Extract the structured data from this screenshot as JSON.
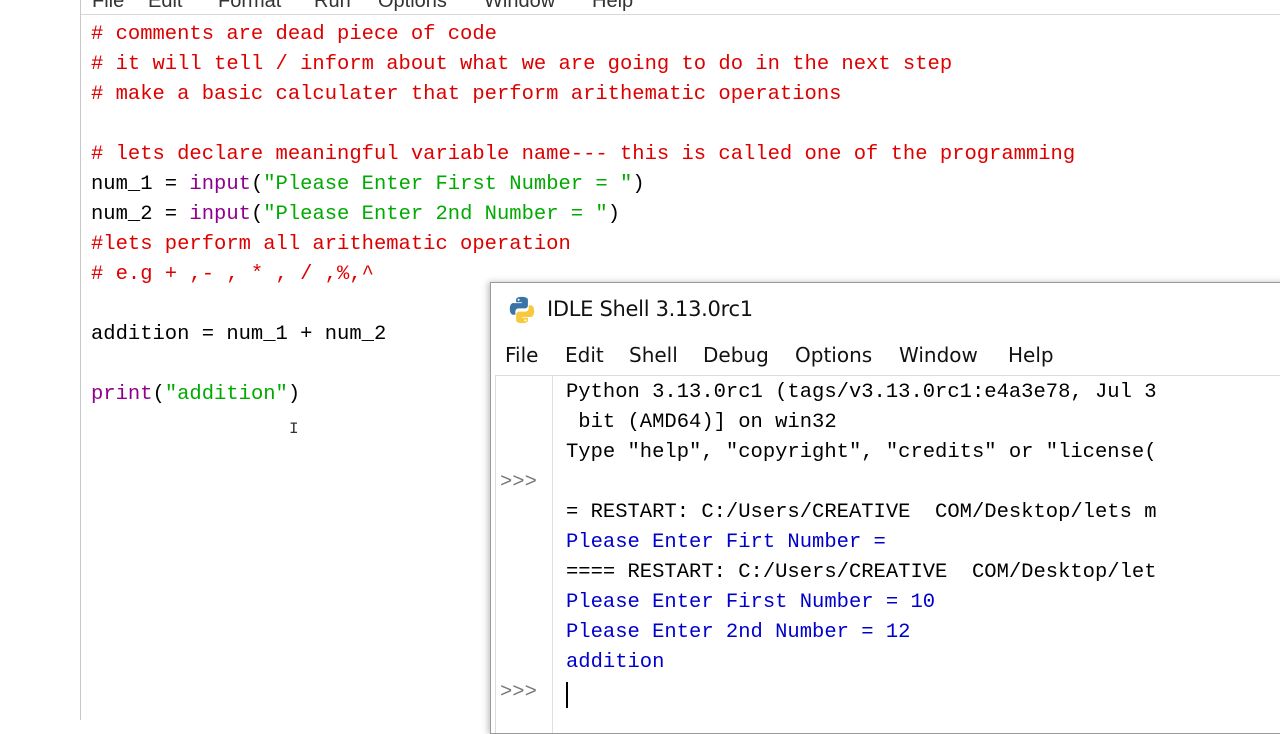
{
  "editor_menu": [
    "File",
    "Edit",
    "Format",
    "Run",
    "Options",
    "Window",
    "Help"
  ],
  "editor_lines": [
    {
      "segments": [
        {
          "t": "# comments are dead piece of code",
          "c": "comment"
        }
      ]
    },
    {
      "segments": [
        {
          "t": "# it will tell / inform about what we are going to do in the next step",
          "c": "comment"
        }
      ]
    },
    {
      "segments": [
        {
          "t": "# make a basic calculater that perform arithematic operations",
          "c": "comment"
        }
      ]
    },
    {
      "segments": []
    },
    {
      "segments": [
        {
          "t": "# lets declare meaningful variable name--- this is called one of the programming",
          "c": "comment"
        }
      ]
    },
    {
      "segments": [
        {
          "t": "num_1 = ",
          "c": "plain"
        },
        {
          "t": "input",
          "c": "builtin"
        },
        {
          "t": "(",
          "c": "plain"
        },
        {
          "t": "\"Please Enter First Number = \"",
          "c": "string"
        },
        {
          "t": ")",
          "c": "plain"
        }
      ]
    },
    {
      "segments": [
        {
          "t": "num_2 = ",
          "c": "plain"
        },
        {
          "t": "input",
          "c": "builtin"
        },
        {
          "t": "(",
          "c": "plain"
        },
        {
          "t": "\"Please Enter 2nd Number = \"",
          "c": "string"
        },
        {
          "t": ")",
          "c": "plain"
        }
      ]
    },
    {
      "segments": [
        {
          "t": "#lets perform all arithematic operation",
          "c": "comment"
        }
      ]
    },
    {
      "segments": [
        {
          "t": "# e.g + ,- , * , / ,%,^",
          "c": "comment"
        }
      ]
    },
    {
      "segments": []
    },
    {
      "segments": [
        {
          "t": "addition = num_1 + num_2",
          "c": "plain"
        }
      ]
    },
    {
      "segments": []
    },
    {
      "segments": [
        {
          "t": "print",
          "c": "builtin"
        },
        {
          "t": "(",
          "c": "plain"
        },
        {
          "t": "\"addition\"",
          "c": "string"
        },
        {
          "t": ")",
          "c": "plain"
        }
      ]
    }
  ],
  "shell": {
    "title": "IDLE Shell 3.13.0rc1",
    "menu": [
      "File",
      "Edit",
      "Shell",
      "Debug",
      "Options",
      "Window",
      "Help"
    ],
    "prompt_symbol": ">>>",
    "lines": [
      {
        "text": "Python 3.13.0rc1 (tags/v3.13.0rc1:e4a3e78, Jul 3",
        "style": "black"
      },
      {
        "text": " bit (AMD64)] on win32",
        "style": "black"
      },
      {
        "text": "Type \"help\", \"copyright\", \"credits\" or \"license(",
        "style": "black"
      },
      {
        "text": "",
        "style": "black"
      },
      {
        "text": "= RESTART: C:/Users/CREATIVE  COM/Desktop/lets m",
        "style": "black"
      },
      {
        "text": "Please Enter Firt Number =",
        "style": "blue"
      },
      {
        "text": "==== RESTART: C:/Users/CREATIVE  COM/Desktop/let",
        "style": "black"
      },
      {
        "text": "Please Enter First Number = 10",
        "style": "blue"
      },
      {
        "text": "Please Enter 2nd Number = 12",
        "style": "blue"
      },
      {
        "text": "addition",
        "style": "blue"
      },
      {
        "text": "",
        "style": "black"
      }
    ],
    "prompt_lines": [
      3,
      10
    ]
  }
}
